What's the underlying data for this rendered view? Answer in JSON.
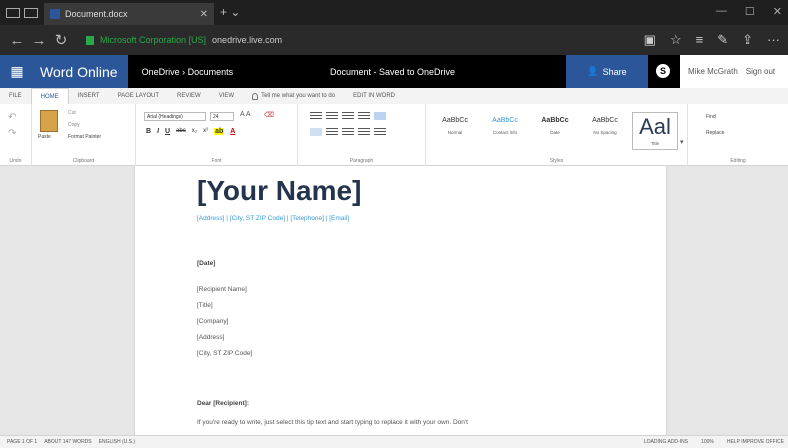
{
  "browser": {
    "tab_title": "Document.docx",
    "tab_close": "✕",
    "new_tab": "+  ⌄",
    "back": "←",
    "forward": "→",
    "refresh": "↻",
    "url_secure": "Microsoft Corporation [US]",
    "url_domain": "onedrive.live.com",
    "win_min": "—",
    "win_max": "☐",
    "win_close": "✕",
    "reading_icon": "▣",
    "fav_star": "☆",
    "hub": "≡",
    "notes": "✎",
    "share_icon": "⇪",
    "more": "···"
  },
  "office": {
    "waffle": "▦",
    "app_name": "Word Online",
    "breadcrumb": "OneDrive › Documents",
    "doc_title": "Document  -  Saved to OneDrive",
    "share_label": "Share",
    "skype": "S",
    "user_name": "Mike McGrath",
    "sign_out": "Sign out"
  },
  "ribbon_tabs": [
    "FILE",
    "HOME",
    "INSERT",
    "PAGE LAYOUT",
    "REVIEW",
    "VIEW"
  ],
  "tell_me": "Tell me what you want to do",
  "edit_in_word": "EDIT IN WORD",
  "ribbon": {
    "paste": "Paste",
    "cut": "Cut",
    "copy": "Copy",
    "format_painter": "Format Painter",
    "clipboard": "Clipboard",
    "undo": "Undo",
    "font_name": "Arial (Headings)",
    "font_size": "24",
    "bold": "B",
    "italic": "I",
    "underline": "U",
    "strike": "abc",
    "font_group": "Font",
    "paragraph_group": "Paragraph",
    "styles_group": "Styles",
    "editing_group": "Editing",
    "find": "Find",
    "replace": "Replace",
    "styles": [
      {
        "sample": "AaBbCc",
        "name": "Normal"
      },
      {
        "sample": "AaBbCc",
        "name": "Contact Info"
      },
      {
        "sample": "AaBbCc",
        "name": "Date"
      },
      {
        "sample": "AaBbCc",
        "name": "No Spacing"
      },
      {
        "sample": "Aal",
        "name": "Title"
      }
    ]
  },
  "document": {
    "name": "[Your Name]",
    "contact": "[Address] | [City, ST ZIP Code] | [Telephone] | [Email]",
    "date": "[Date]",
    "recipient_lines": [
      "[Recipient Name]",
      "[Title]",
      "[Company]",
      "[Address]",
      "[City, ST ZIP Code]"
    ],
    "salutation": "Dear [Recipient]:",
    "body": "If you're ready to write, just select this tip text and start typing to replace it with your own. Don't"
  },
  "status": {
    "page": "PAGE 1 OF 1",
    "word_count": "ABOUT 147 WORDS",
    "language": "ENGLISH (U.S.)",
    "saving": "LOADING ADD-INS",
    "zoom": "100%",
    "help": "HELP IMPROVE OFFICE"
  }
}
